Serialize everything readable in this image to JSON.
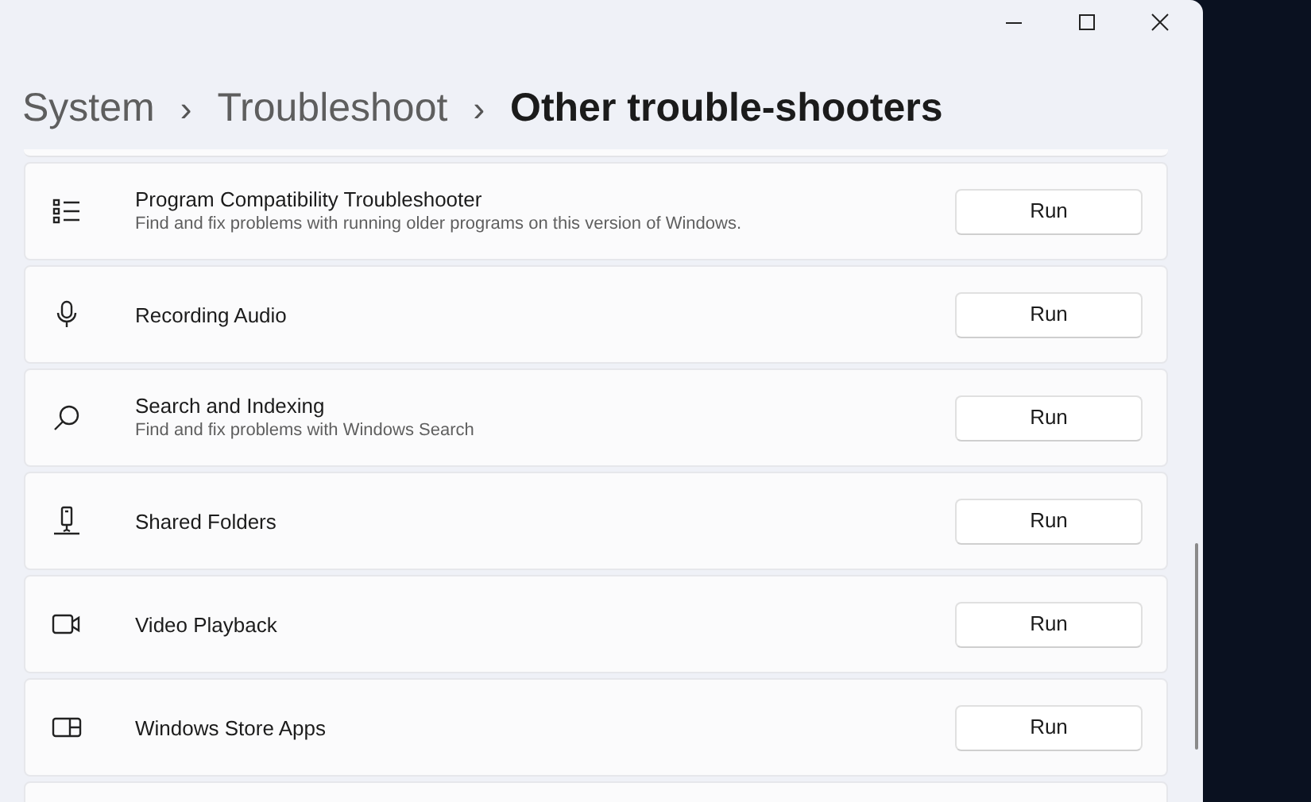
{
  "breadcrumb": [
    {
      "label": "System",
      "current": false
    },
    {
      "label": "Troubleshoot",
      "current": false
    },
    {
      "label": "Other trouble-shooters",
      "current": true
    }
  ],
  "separator": "›",
  "troubleshooters": [
    {
      "title": "Program Compatibility Troubleshooter",
      "description": "Find and fix problems with running older programs on this version of Windows.",
      "button": "Run"
    },
    {
      "title": "Recording Audio",
      "button": "Run"
    },
    {
      "title": "Search and Indexing",
      "description": "Find and fix problems with Windows Search",
      "button": "Run"
    },
    {
      "title": "Shared Folders",
      "button": "Run"
    },
    {
      "title": "Video Playback",
      "button": "Run"
    },
    {
      "title": "Windows Store Apps",
      "button": "Run"
    }
  ]
}
